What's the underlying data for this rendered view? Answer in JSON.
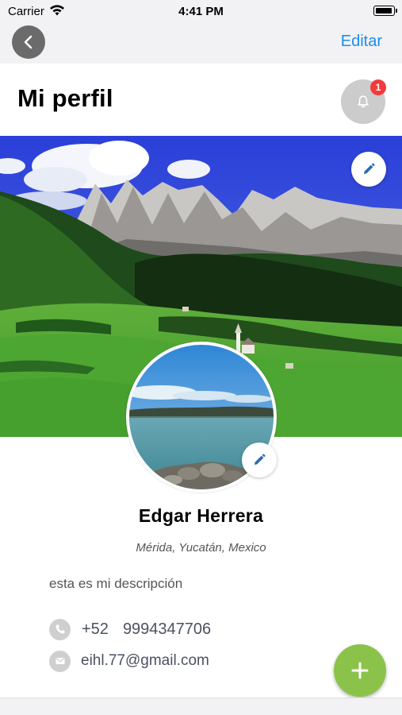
{
  "status_bar": {
    "carrier": "Carrier",
    "time": "4:41 PM"
  },
  "nav": {
    "back_icon": "chevron-left-icon",
    "edit_label": "Editar"
  },
  "header": {
    "title": "Mi perfil",
    "notifications_icon": "bell-icon",
    "notification_count": "1"
  },
  "profile": {
    "name": "Edgar Herrera",
    "location": "Mérida, Yucatán, Mexico",
    "description": "esta es mi descripción",
    "phone_prefix": "+52",
    "phone_number": "9994347706",
    "email": "eihl.77@gmail.com"
  },
  "colors": {
    "accent": "#1a8df0",
    "fab": "#8bc34a",
    "badge": "#f13b3b",
    "edit_pencil": "#2b6cb0"
  },
  "icons": {
    "cover_edit": "pencil-icon",
    "avatar_edit": "pencil-icon",
    "phone": "phone-icon",
    "email": "mail-icon",
    "fab": "plus-icon"
  }
}
